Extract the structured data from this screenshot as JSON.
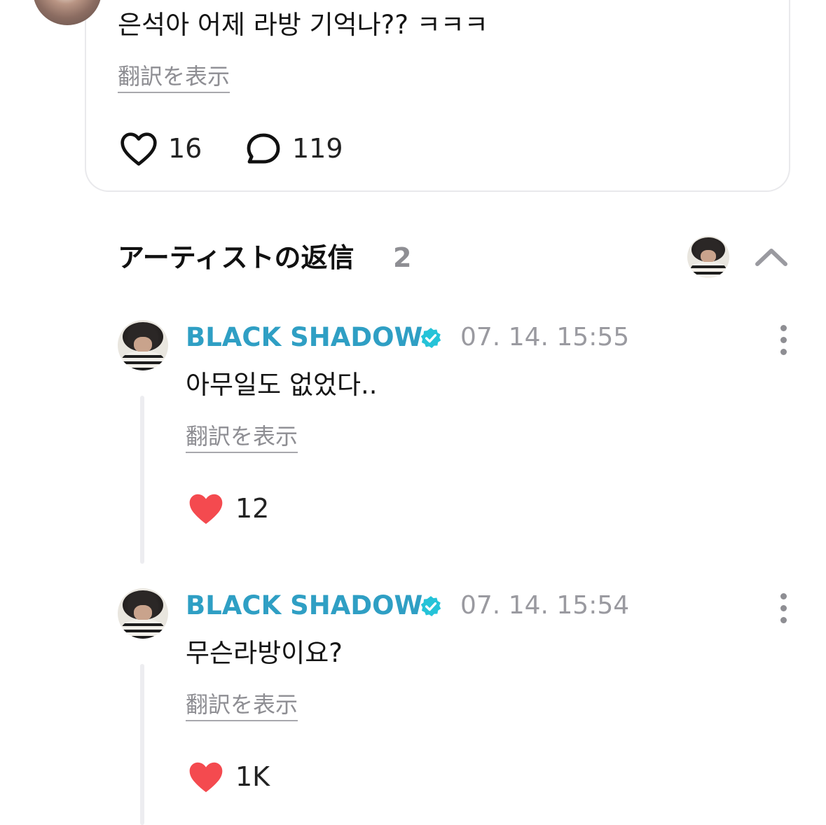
{
  "post": {
    "text": "은석아 어제 라방 기억나?? ㅋㅋㅋ",
    "translate_label": "翻訳を表示",
    "likes": "16",
    "comments": "119"
  },
  "artist_replies": {
    "title": "アーティストの返信",
    "count": "2"
  },
  "replies": [
    {
      "author": "BLACK SHADOW",
      "timestamp": "07. 14. 15:55",
      "text": "아무일도 없었다..",
      "translate_label": "翻訳を表示",
      "likes": "12"
    },
    {
      "author": "BLACK SHADOW",
      "timestamp": "07. 14. 15:54",
      "text": "무슨라방이요?",
      "translate_label": "翻訳を表示",
      "likes": "1K"
    }
  ],
  "icons": {
    "like": "heart-outline-icon",
    "comment": "speech-bubble-icon",
    "liked": "heart-filled-icon",
    "verified": "verified-badge-icon",
    "more": "more-vertical-icon",
    "collapse": "chevron-up-icon"
  },
  "colors": {
    "artist_name": "#2f9fc4",
    "verified": "#25c3d8",
    "heart": "#f44a4f",
    "muted": "#8e8e93"
  }
}
